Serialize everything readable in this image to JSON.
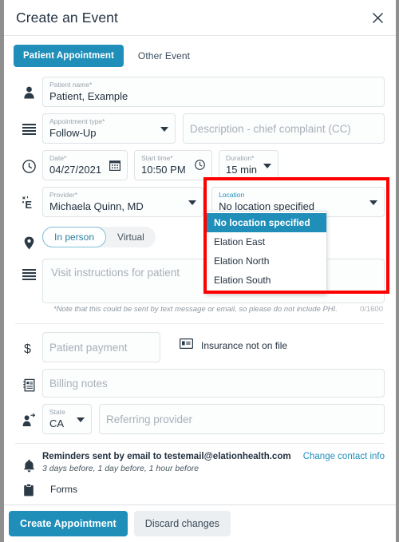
{
  "window": {
    "title": "Create an Event",
    "close_icon": "close-icon"
  },
  "tabs": [
    {
      "label": "Patient Appointment",
      "active": true
    },
    {
      "label": "Other Event",
      "active": false
    }
  ],
  "form": {
    "patient_name": {
      "icon": "person-icon",
      "label": "Patient name*",
      "value": "Patient, Example"
    },
    "appointment_type": {
      "icon": "list-icon",
      "label": "Appointment type*",
      "value": "Follow-Up"
    },
    "description": {
      "placeholder": "Description - chief complaint (CC)"
    },
    "date": {
      "icon": "clock-icon",
      "label": "Date*",
      "value": "04/27/2021",
      "field_icon": "calendar-icon"
    },
    "start_time": {
      "label": "Start time*",
      "value": "10:50 PM",
      "field_icon": "clock-icon"
    },
    "duration": {
      "label": "Duration*",
      "value": "15 min"
    },
    "provider": {
      "icon": "stethoscope-icon",
      "label": "Provider*",
      "value": "Michaela Quinn, MD"
    },
    "location": {
      "label": "Location",
      "value": "No location specified",
      "open": true,
      "options": [
        {
          "label": "No location specified",
          "selected": true
        },
        {
          "label": "Elation East",
          "selected": false
        },
        {
          "label": "Elation North",
          "selected": false
        },
        {
          "label": "Elation South",
          "selected": false
        }
      ]
    },
    "visit_mode": {
      "icon": "map-pin-icon",
      "options": [
        {
          "label": "In person",
          "active": true
        },
        {
          "label": "Virtual",
          "active": false
        }
      ]
    },
    "visit_instructions": {
      "icon": "list-icon",
      "placeholder": "Visit instructions for patient",
      "note": "*Note that this could be sent by text message or email, so please do not include PHI.",
      "counter": "0/1600"
    },
    "patient_payment": {
      "icon": "dollar-icon",
      "placeholder": "Patient payment"
    },
    "insurance": {
      "icon": "id-card-icon",
      "text": "Insurance not on file"
    },
    "billing_notes": {
      "icon": "clipboard-notes-icon",
      "placeholder": "Billing notes"
    },
    "state": {
      "icon": "referring-provider-icon",
      "label": "State",
      "value": "CA"
    },
    "referring_provider": {
      "placeholder": "Referring provider"
    },
    "reminders": {
      "icon": "bell-icon",
      "line1": "Reminders sent by email to testemail@elationhealth.com",
      "line2": "3 days before, 1 day before, 1 hour before",
      "link": "Change contact info"
    },
    "forms": {
      "icon": "clipboard-icon",
      "label": "Forms"
    }
  },
  "footer": {
    "primary": "Create Appointment",
    "secondary": "Discard changes"
  },
  "colors": {
    "accent": "#1f8fba",
    "annotation": "#fe0000",
    "text": "#23313f",
    "placeholder": "#a7b0b8"
  }
}
